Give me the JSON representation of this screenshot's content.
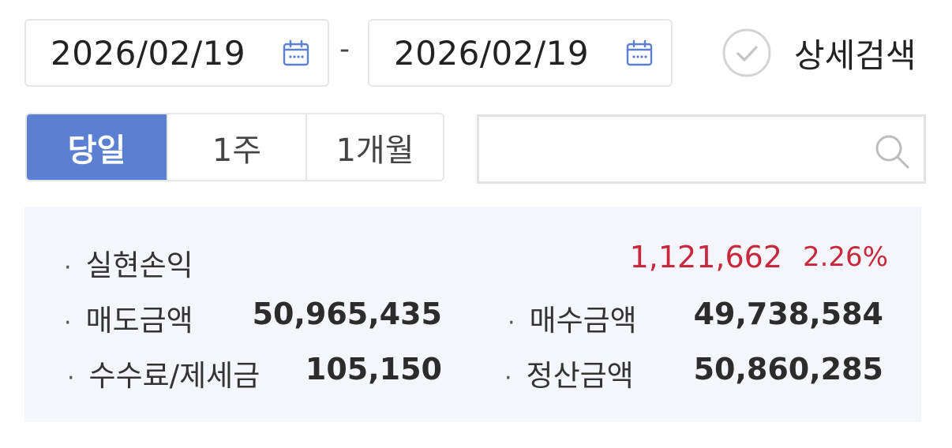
{
  "date_range": {
    "from": "2026/02/19",
    "separator": "-",
    "to": "2026/02/19"
  },
  "detail_search": {
    "label": "상세검색"
  },
  "period": {
    "buttons": [
      "당일",
      "1주",
      "1개월"
    ],
    "selected": "당일"
  },
  "search": {
    "value": "",
    "placeholder": ""
  },
  "summary": {
    "realized_pnl": {
      "label": "실현손익",
      "value": "1,121,662",
      "rate": "2.26%"
    },
    "sell_amount": {
      "label": "매도금액",
      "value": "50,965,435"
    },
    "buy_amount": {
      "label": "매수금액",
      "value": "49,738,584"
    },
    "fee_tax": {
      "label": "수수료/제세금",
      "value": "105,150"
    },
    "settlement": {
      "label": "정산금액",
      "value": "50,860,285"
    },
    "bullet": "·"
  },
  "colors": {
    "accent": "#5b80d2",
    "profit": "#c8283c",
    "panel_bg": "#f4f6fb",
    "border": "#e6e6e6"
  }
}
